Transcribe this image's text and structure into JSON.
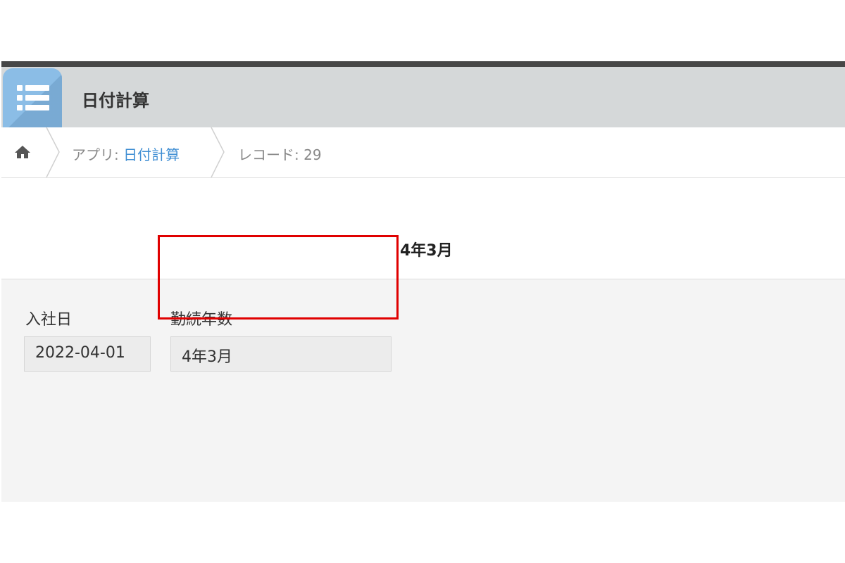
{
  "header": {
    "app_title": "日付計算",
    "app_icon": "list-icon",
    "colors": {
      "header_bg": "#d5d8d9",
      "icon_bg": "#8bbde6",
      "top_strip": "#474747"
    }
  },
  "breadcrumb": {
    "home_icon": "home-icon",
    "app_prefix": "アプリ: ",
    "app_link": "日付計算",
    "record": "レコード: 29",
    "link_color": "#3f8ed3"
  },
  "record": {
    "fields": [
      {
        "label": "入社日",
        "value": "2022-04-01"
      },
      {
        "label": "勤続年数",
        "value": "4年3月"
      }
    ],
    "calculated_text": "4年3月",
    "highlight_color": "#e00000"
  }
}
